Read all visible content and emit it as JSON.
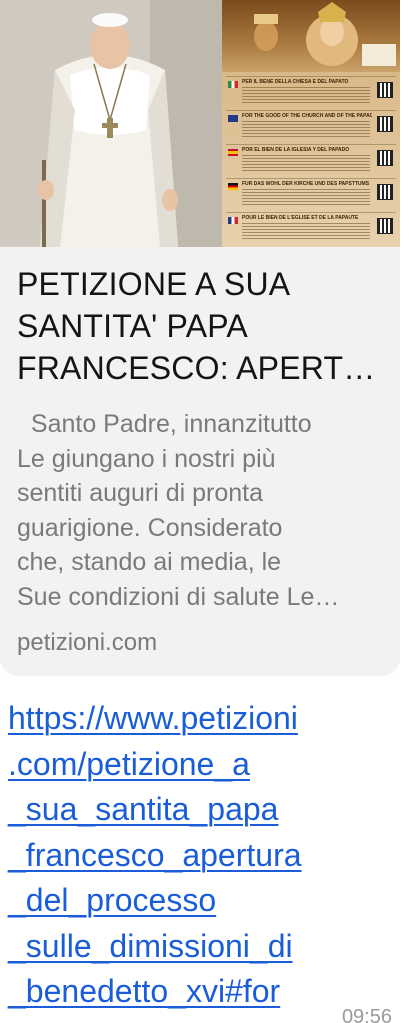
{
  "preview": {
    "title_lines": [
      "PETIZIONE A SUA",
      "SANTITA' PAPA",
      "FRANCESCO: APERT…"
    ],
    "description_lines": [
      "  Santo Padre, innanzitutto",
      "Le giungano i nostri più",
      "sentiti auguri di pronta",
      "guarigione. Considerato",
      "che, stando ai media, le",
      "Sue condizioni di salute Le…"
    ],
    "domain": "petizioni.com",
    "poster": {
      "rows": [
        {
          "text": "PER IL BENE DELLA CHIESA E DEL PAPATO",
          "flag": "it"
        },
        {
          "text": "FOR THE GOOD OF THE CHURCH AND OF THE PAPACY",
          "flag": "uk"
        },
        {
          "text": "POR EL BIEN DE LA IGLESIA Y DEL PAPADO",
          "flag": "es"
        },
        {
          "text": "FÜR DAS WOHL DER KIRCHE UND DES PAPSTTUMS",
          "flag": "de"
        },
        {
          "text": "POUR LE BIEN DE L'ÉGLISE ET DE LA PAPAUTÉ",
          "flag": "fr"
        }
      ]
    }
  },
  "message": {
    "link_lines": [
      "https://www.petizioni",
      ".com/petizione_a",
      "_sua_santita_papa",
      "_francesco_apertura",
      "_del_processo",
      "_sulle_dimissioni_di",
      "_benedetto_xvi#for"
    ],
    "time": "09:56"
  },
  "colors": {
    "card_background": "#f2f2f2",
    "link": "#1a5dd8",
    "title": "#141414",
    "secondary_text": "#7a7a7a"
  }
}
